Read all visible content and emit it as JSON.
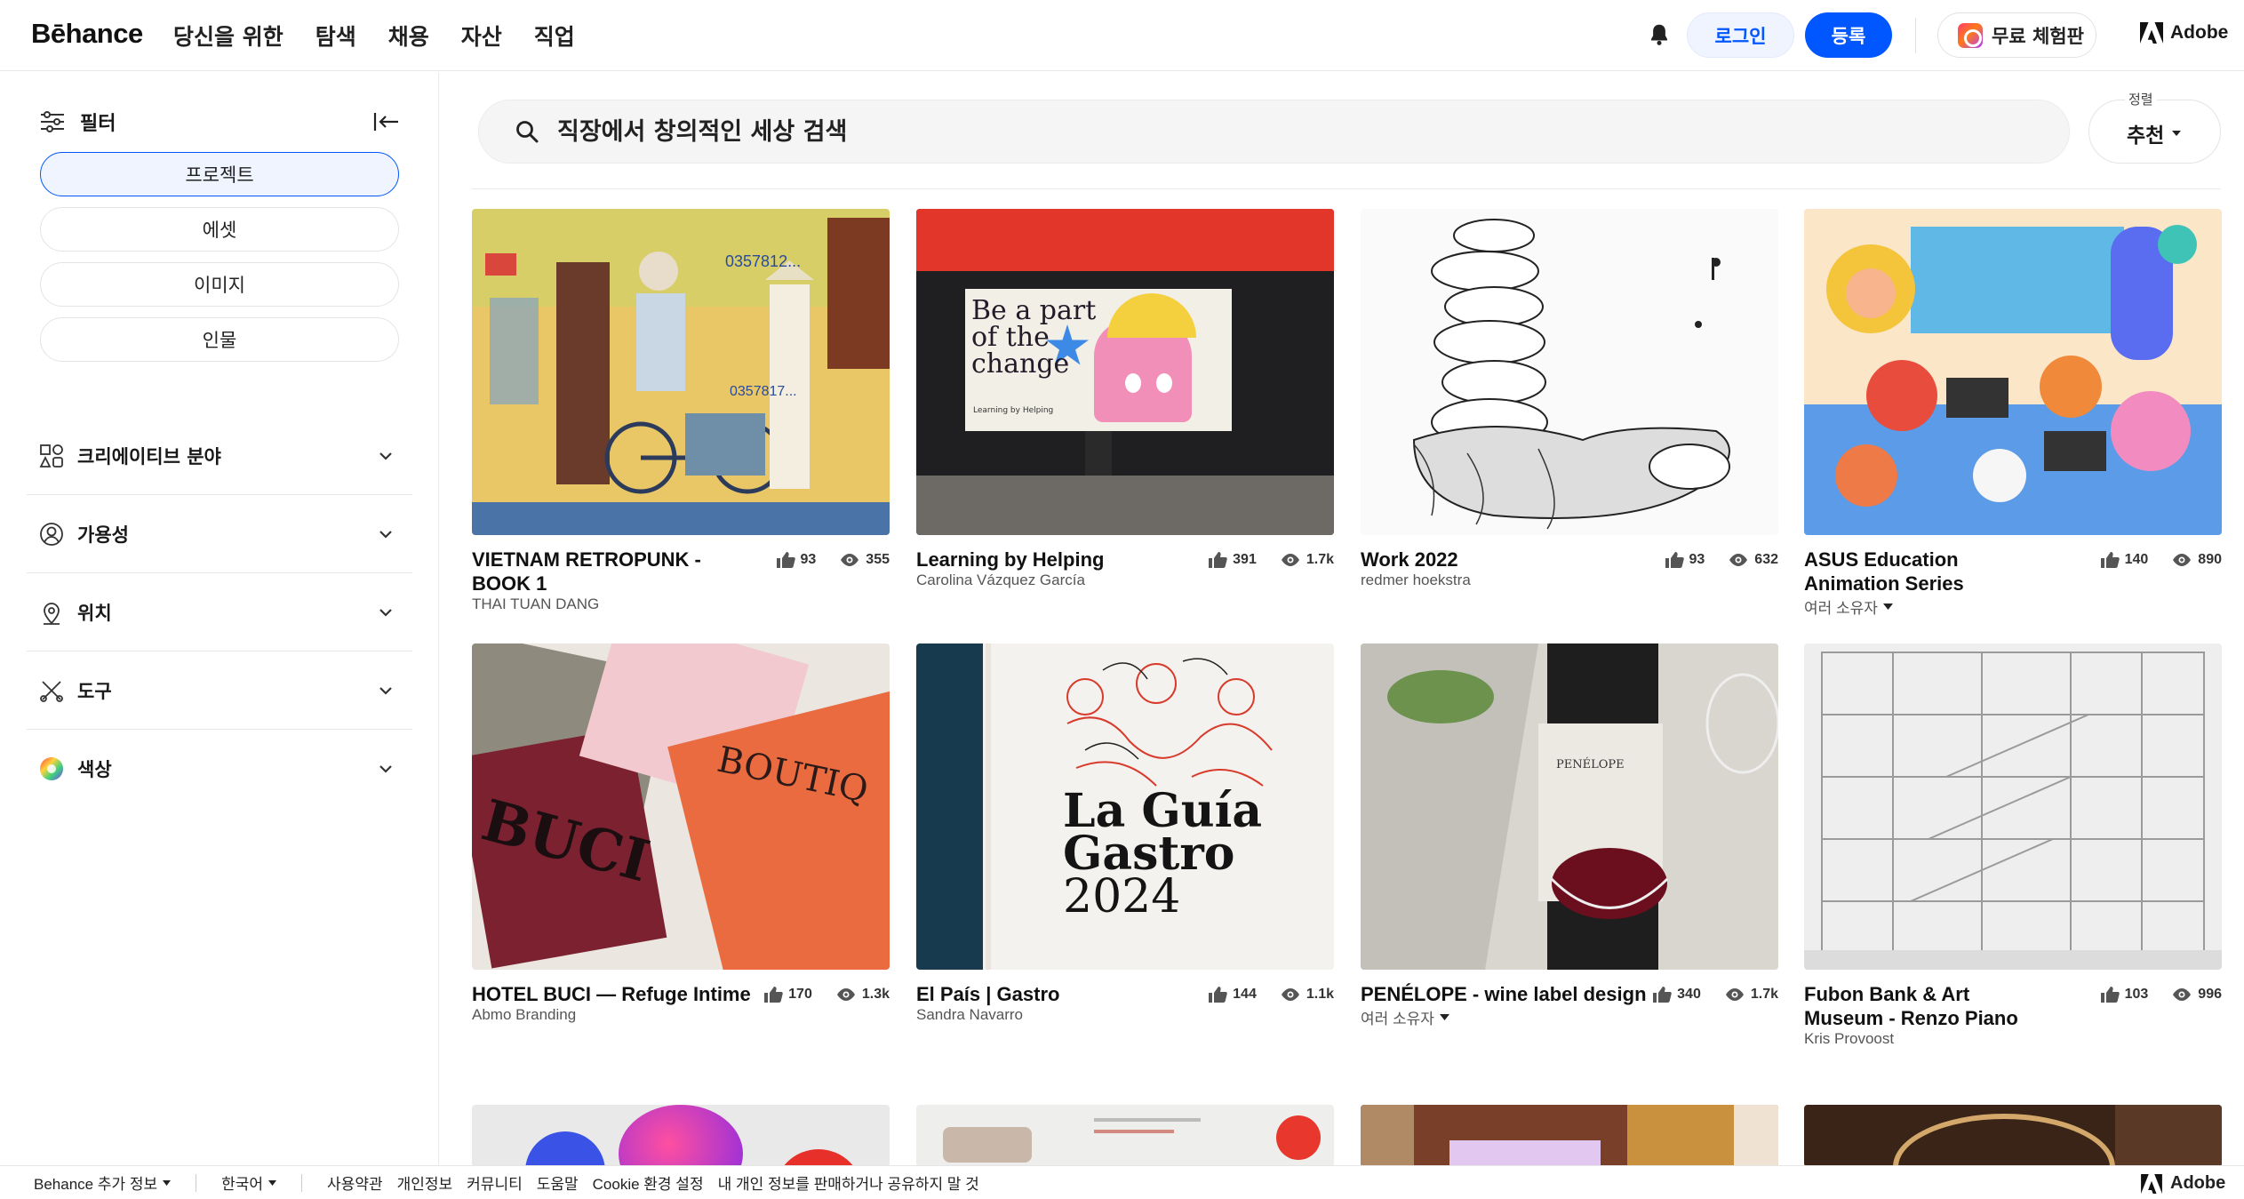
{
  "header": {
    "logo": "Bēhance",
    "nav": [
      "당신을 위한",
      "탐색",
      "채용",
      "자산",
      "직업"
    ],
    "login": "로그인",
    "register": "등록",
    "trial": "무료 체험판",
    "adobe": "Adobe"
  },
  "sidebar": {
    "filter_label": "필터",
    "types": [
      "프로젝트",
      "에셋",
      "이미지",
      "인물"
    ],
    "sections": [
      "크리에이티브 분야",
      "가용성",
      "위치",
      "도구",
      "색상"
    ]
  },
  "search": {
    "placeholder": "직장에서 창의적인 세상 검색"
  },
  "sort": {
    "caption": "정렬",
    "value": "추천"
  },
  "projects": [
    {
      "title": "VIETNAM RETROPUNK - BOOK 1",
      "owner": "THAI TUAN DANG",
      "likes": "93",
      "views": "355"
    },
    {
      "title": "Learning by Helping",
      "owner": "Carolina Vázquez García",
      "likes": "391",
      "views": "1.7k",
      "thumb_text": [
        "Be a part",
        "of the",
        "change",
        "Learning by Helping"
      ]
    },
    {
      "title": "Work 2022",
      "owner": "redmer hoekstra",
      "likes": "93",
      "views": "632"
    },
    {
      "title": "ASUS Education Animation Series",
      "owner": "여러 소유자",
      "likes": "140",
      "views": "890"
    },
    {
      "title": "HOTEL BUCI — Refuge Intime",
      "owner": "Abmo Branding",
      "likes": "170",
      "views": "1.3k",
      "thumb_text": [
        "BUCI",
        "BOUTIQ"
      ]
    },
    {
      "title": "El País | Gastro",
      "owner": "Sandra Navarro",
      "likes": "144",
      "views": "1.1k",
      "thumb_text": [
        "La Guía",
        "Gastro",
        "2024"
      ]
    },
    {
      "title": "PENÉLOPE - wine label design",
      "owner": "여러 소유자",
      "likes": "340",
      "views": "1.7k",
      "thumb_text": [
        "PENÉLOPE"
      ]
    },
    {
      "title": "Fubon Bank & Art Museum - Renzo Piano",
      "owner": "Kris Provoost",
      "likes": "103",
      "views": "996"
    }
  ],
  "footer": {
    "more": "Behance 추가 정보",
    "lang": "한국어",
    "links": [
      "사용약관",
      "개인정보",
      "커뮤니티",
      "도움말",
      "Cookie 환경 설정",
      "내 개인 정보를 판매하거나 공유하지 말 것"
    ],
    "adobe": "Adobe"
  }
}
